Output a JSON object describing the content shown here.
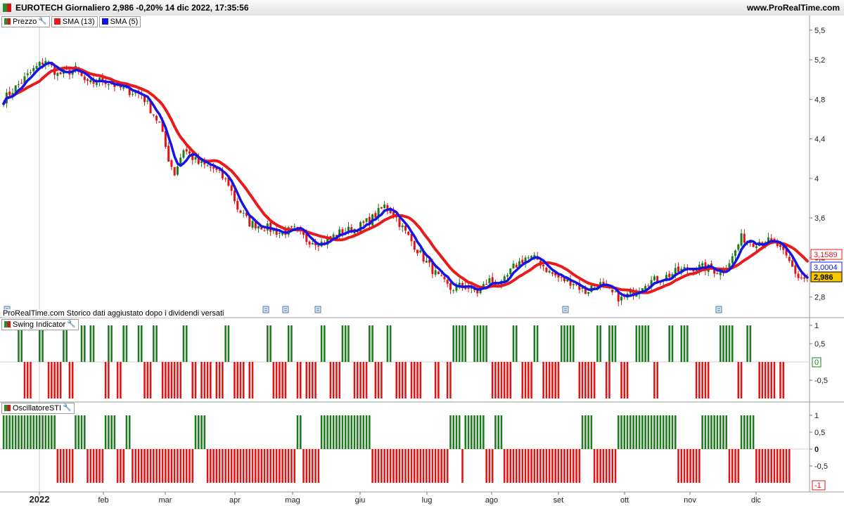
{
  "header": {
    "title": "EUROTECH Giornaliero 2,986 -0,20% 14 dic 2022, 17:35:56",
    "brand": "www.ProRealTime.com"
  },
  "legend_main": {
    "price": "Prezzo",
    "sma13": "SMA (13)",
    "sma5": "SMA (5)"
  },
  "note": "ProRealTime.com Storico dati aggiustato dopo i dividendi versati",
  "legend_swing": "Swing Indicator",
  "legend_osc": "OscillatoreSTI",
  "colors": {
    "up": "#1e7b1e",
    "down": "#e01414",
    "sma13": "#e81a1a",
    "sma5": "#1414e6"
  },
  "chart_data": [
    {
      "type": "line",
      "title": "EUROTECH Giornaliero",
      "x_labels": [
        "2022",
        "feb",
        "mar",
        "apr",
        "mag",
        "giu",
        "lug",
        "ago",
        "set",
        "ott",
        "nov",
        "dic"
      ],
      "ylim": [
        2.62,
        5.62
      ],
      "y_ticks": [
        "2,8",
        "3,2",
        "3,6",
        "4",
        "4,4",
        "4,8",
        "5,2",
        "5,5"
      ],
      "y_tick_values": [
        2.8,
        3.2,
        3.6,
        4.0,
        4.4,
        4.8,
        5.2,
        5.5
      ],
      "price_keypoints": [
        [
          0,
          4.8
        ],
        [
          5,
          4.95
        ],
        [
          10,
          5.1
        ],
        [
          14,
          5.2
        ],
        [
          18,
          5.05
        ],
        [
          24,
          5.1
        ],
        [
          28,
          4.95
        ],
        [
          33,
          5.0
        ],
        [
          40,
          4.9
        ],
        [
          46,
          4.85
        ],
        [
          49,
          4.7
        ],
        [
          52,
          4.55
        ],
        [
          55,
          4.2
        ],
        [
          57,
          4.05
        ],
        [
          60,
          4.3
        ],
        [
          65,
          4.15
        ],
        [
          70,
          4.1
        ],
        [
          75,
          3.95
        ],
        [
          78,
          3.7
        ],
        [
          82,
          3.55
        ],
        [
          88,
          3.5
        ],
        [
          92,
          3.45
        ],
        [
          97,
          3.48
        ],
        [
          101,
          3.38
        ],
        [
          106,
          3.35
        ],
        [
          112,
          3.45
        ],
        [
          118,
          3.5
        ],
        [
          123,
          3.6
        ],
        [
          127,
          3.72
        ],
        [
          130,
          3.65
        ],
        [
          133,
          3.5
        ],
        [
          137,
          3.32
        ],
        [
          141,
          3.15
        ],
        [
          145,
          3.0
        ],
        [
          149,
          2.88
        ],
        [
          153,
          2.92
        ],
        [
          158,
          2.85
        ],
        [
          162,
          2.97
        ],
        [
          166,
          2.92
        ],
        [
          170,
          3.1
        ],
        [
          174,
          3.2
        ],
        [
          178,
          3.18
        ],
        [
          182,
          3.05
        ],
        [
          186,
          2.98
        ],
        [
          190,
          2.95
        ],
        [
          194,
          2.85
        ],
        [
          198,
          2.95
        ],
        [
          202,
          2.85
        ],
        [
          206,
          2.78
        ],
        [
          210,
          2.85
        ],
        [
          214,
          2.95
        ],
        [
          219,
          2.98
        ],
        [
          224,
          3.05
        ],
        [
          229,
          3.1
        ],
        [
          234,
          3.1
        ],
        [
          239,
          3.05
        ],
        [
          243,
          3.2
        ],
        [
          246,
          3.4
        ],
        [
          250,
          3.35
        ],
        [
          254,
          3.38
        ],
        [
          258,
          3.32
        ],
        [
          262,
          3.15
        ],
        [
          265,
          3.0
        ],
        [
          268,
          2.98
        ]
      ],
      "series": [
        {
          "name": "Prezzo",
          "last": "2,986"
        },
        {
          "name": "SMA (13)",
          "last": "3,1589"
        },
        {
          "name": "SMA (5)",
          "last": "3,0004"
        }
      ]
    },
    {
      "type": "bar",
      "title": "Swing Indicator",
      "ylim": [
        -1.0,
        1.0
      ],
      "y_ticks": [
        "1",
        "0,5",
        "-0,5"
      ],
      "y_tick_values": [
        1,
        0.5,
        -0.5
      ],
      "last_value": "0",
      "positive_bar_index_ranges": [
        [
          5,
          6
        ],
        [
          12,
          13
        ],
        [
          20,
          21
        ],
        [
          26,
          27
        ],
        [
          29,
          30
        ],
        [
          35,
          36
        ],
        [
          40,
          41
        ],
        [
          45,
          46
        ],
        [
          50,
          51
        ],
        [
          60,
          61
        ],
        [
          74,
          75
        ],
        [
          88,
          89
        ],
        [
          95,
          96
        ],
        [
          106,
          107
        ],
        [
          113,
          115
        ],
        [
          122,
          123
        ],
        [
          128,
          129
        ],
        [
          150,
          154
        ],
        [
          157,
          161
        ],
        [
          170,
          171
        ],
        [
          177,
          178
        ],
        [
          186,
          190
        ],
        [
          198,
          199
        ],
        [
          202,
          204
        ],
        [
          211,
          215
        ],
        [
          222,
          223
        ],
        [
          226,
          228
        ],
        [
          239,
          243
        ],
        [
          248,
          249
        ]
      ],
      "negative_bar_index_ranges": [
        [
          7,
          9
        ],
        [
          15,
          19
        ],
        [
          22,
          23
        ],
        [
          34,
          35
        ],
        [
          38,
          39
        ],
        [
          47,
          49
        ],
        [
          53,
          59
        ],
        [
          63,
          64
        ],
        [
          66,
          69
        ],
        [
          71,
          73
        ],
        [
          77,
          80
        ],
        [
          82,
          83
        ],
        [
          90,
          94
        ],
        [
          98,
          99
        ],
        [
          101,
          104
        ],
        [
          109,
          112
        ],
        [
          117,
          121
        ],
        [
          124,
          126
        ],
        [
          131,
          134
        ],
        [
          136,
          139
        ],
        [
          144,
          145
        ],
        [
          148,
          149
        ],
        [
          163,
          169
        ],
        [
          173,
          176
        ],
        [
          180,
          185
        ],
        [
          192,
          197
        ],
        [
          201,
          202
        ],
        [
          206,
          208
        ],
        [
          217,
          218
        ],
        [
          231,
          235
        ],
        [
          245,
          246
        ],
        [
          252,
          257
        ],
        [
          259,
          260
        ]
      ]
    },
    {
      "type": "bar",
      "title": "OscillatoreSTI",
      "ylim": [
        -1.2,
        1.2
      ],
      "y_ticks": [
        "1",
        "0,5",
        "0",
        "-0,5"
      ],
      "y_tick_values": [
        1,
        0.5,
        0,
        -0.5
      ],
      "last_value": "-1",
      "positive_bar_index_ranges": [
        [
          0,
          17
        ],
        [
          24,
          27
        ],
        [
          34,
          37
        ],
        [
          41,
          42
        ],
        [
          64,
          67
        ],
        [
          98,
          99
        ],
        [
          106,
          122
        ],
        [
          149,
          152
        ],
        [
          154,
          160
        ],
        [
          164,
          166
        ],
        [
          193,
          196
        ],
        [
          205,
          224
        ],
        [
          233,
          241
        ],
        [
          246,
          250
        ]
      ],
      "negative_bar_index_ranges": [
        [
          18,
          23
        ],
        [
          28,
          33
        ],
        [
          38,
          40
        ],
        [
          43,
          63
        ],
        [
          68,
          97
        ],
        [
          100,
          105
        ],
        [
          123,
          148
        ],
        [
          153,
          153
        ],
        [
          161,
          163
        ],
        [
          167,
          192
        ],
        [
          197,
          204
        ],
        [
          225,
          232
        ],
        [
          242,
          245
        ],
        [
          251,
          262
        ]
      ]
    }
  ]
}
